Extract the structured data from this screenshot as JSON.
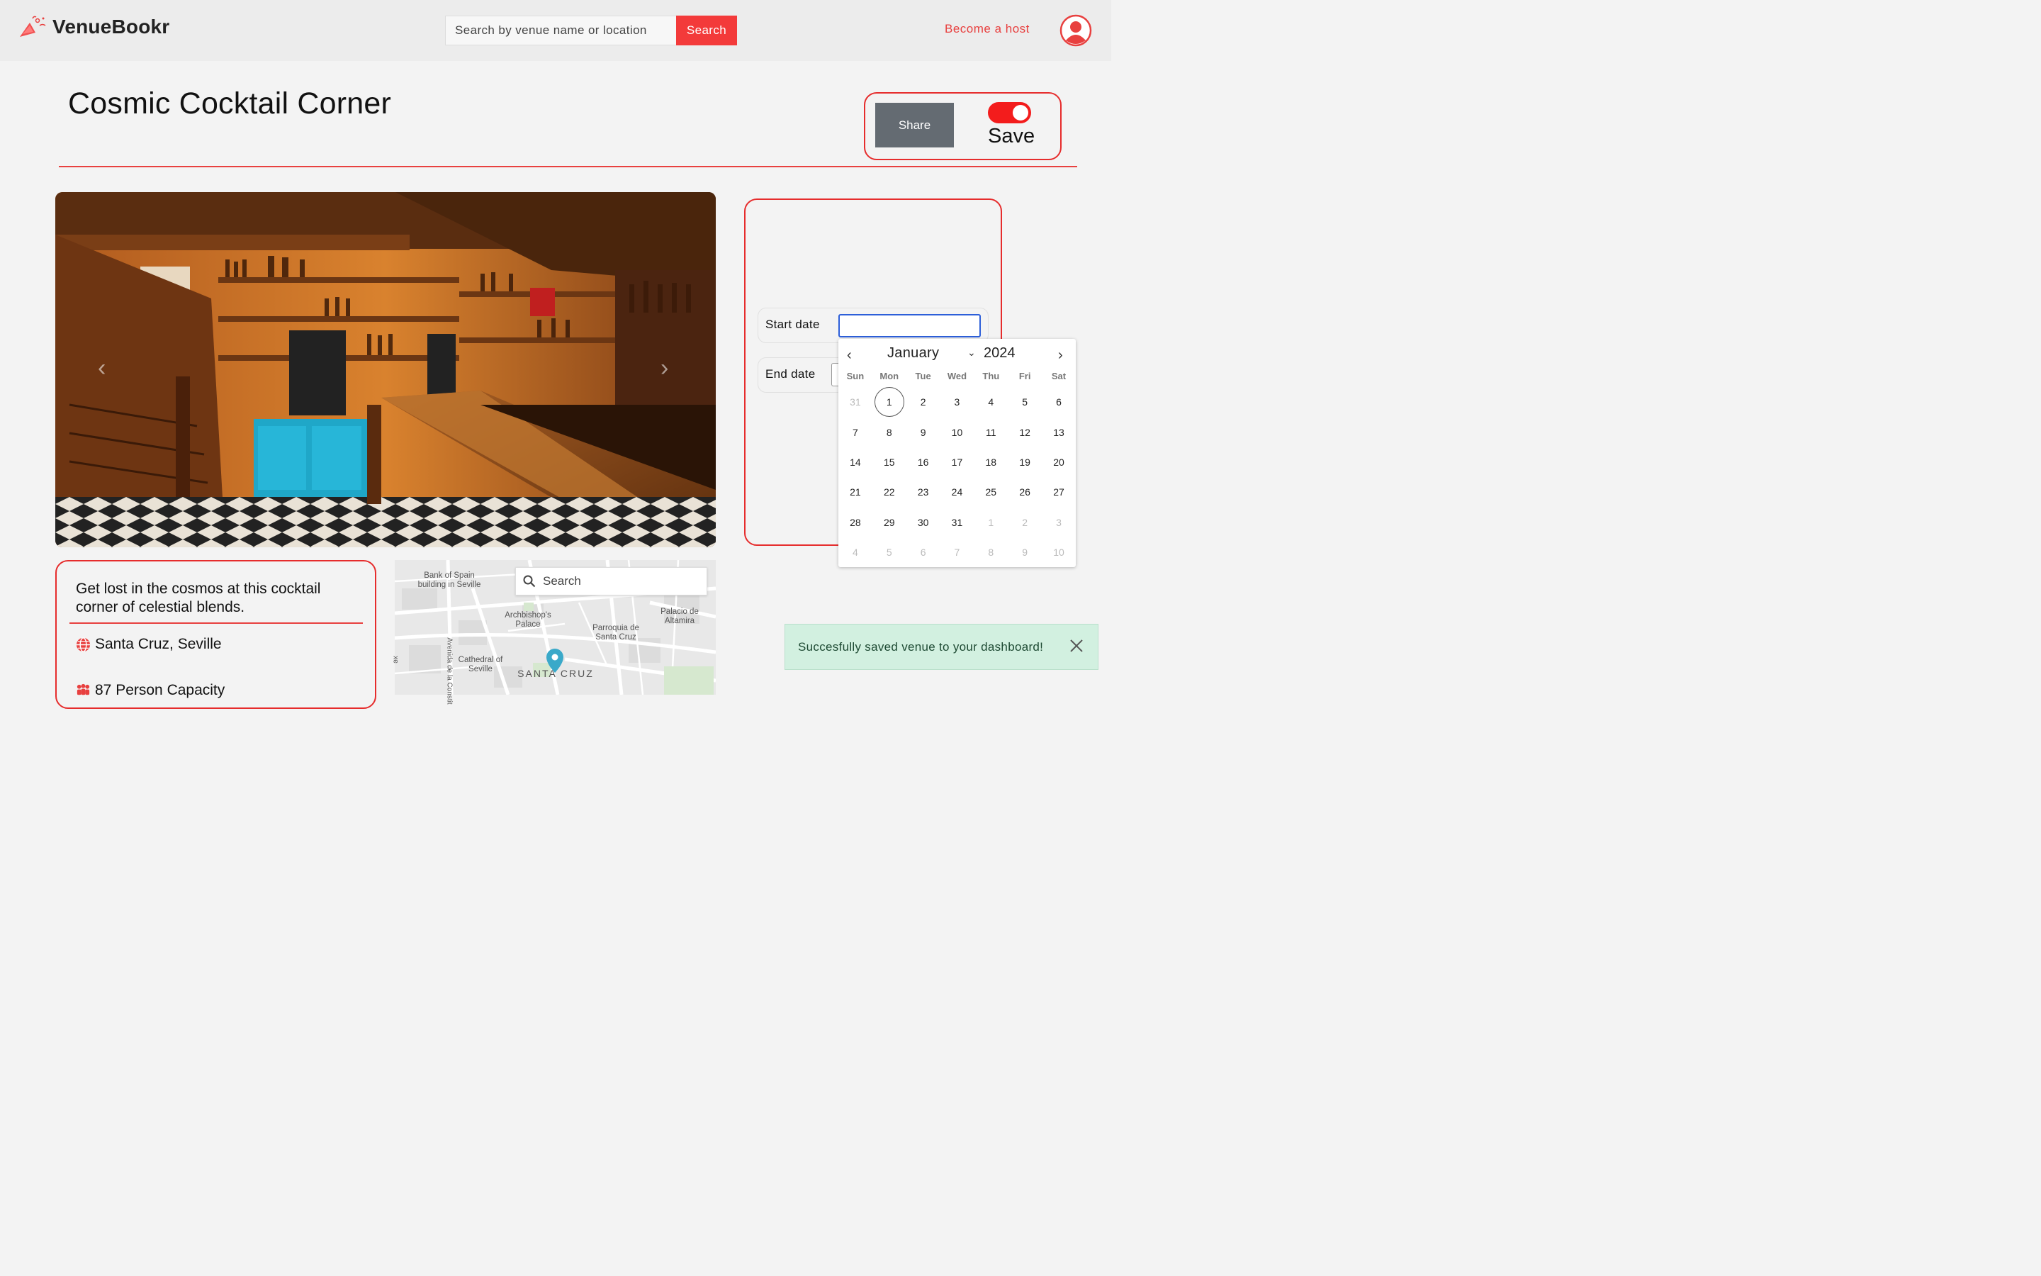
{
  "brand": {
    "name": "VenueBookr"
  },
  "header": {
    "search_placeholder": "Search by venue name or location",
    "search_button": "Search",
    "become_host": "Become a host"
  },
  "venue": {
    "title": "Cosmic Cocktail Corner",
    "description": "Get lost in the cosmos at this cocktail corner of celestial blends.",
    "location": "Santa Cruz, Seville",
    "capacity": "87 Person Capacity"
  },
  "actions": {
    "share": "Share",
    "save": "Save",
    "save_toggle_on": true
  },
  "booking": {
    "start_label": "Start date",
    "end_label": "End date",
    "start_value": "",
    "calendar": {
      "month": "January",
      "year": "2024",
      "weekdays": [
        "Sun",
        "Mon",
        "Tue",
        "Wed",
        "Thu",
        "Fri",
        "Sat"
      ],
      "weeks": [
        [
          "31",
          "1",
          "2",
          "3",
          "4",
          "5",
          "6"
        ],
        [
          "7",
          "8",
          "9",
          "10",
          "11",
          "12",
          "13"
        ],
        [
          "14",
          "15",
          "16",
          "17",
          "18",
          "19",
          "20"
        ],
        [
          "21",
          "22",
          "23",
          "24",
          "25",
          "26",
          "27"
        ],
        [
          "28",
          "29",
          "30",
          "31",
          "1",
          "2",
          "3"
        ],
        [
          "4",
          "5",
          "6",
          "7",
          "8",
          "9",
          "10"
        ]
      ],
      "today": "1"
    }
  },
  "map": {
    "search_placeholder": "Search",
    "labels": {
      "bank": "Bank of Spain building in Seville",
      "archbishop": "Archbishop's Palace",
      "parroquia": "Parroquia de Santa Cruz",
      "palacio": "Palacio de Altamira",
      "cathedral": "Cathedral of Seville",
      "district": "SANTA CRUZ",
      "avenida": "Avenida de la Constit",
      "edge": "xe"
    }
  },
  "toast": {
    "message": "Succesfully saved venue to your dashboard!"
  },
  "colors": {
    "accent": "#e8403f",
    "toggle": "#f31c1c",
    "toast_bg": "#d2f0e0",
    "focus": "#2d5fd9"
  }
}
